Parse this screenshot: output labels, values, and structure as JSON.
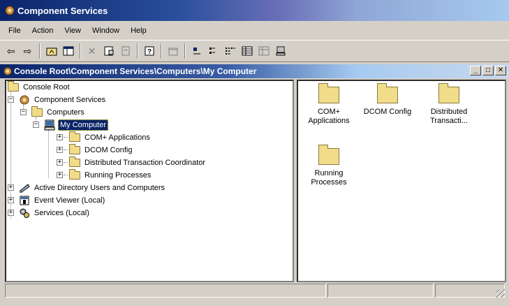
{
  "app": {
    "title": "Component Services"
  },
  "menu": [
    {
      "label": "File"
    },
    {
      "label": "Action"
    },
    {
      "label": "View"
    },
    {
      "label": "Window"
    },
    {
      "label": "Help"
    }
  ],
  "toolbar": {
    "buttons": [
      "back-arrow-icon",
      "forward-arrow-icon",
      "up-folder-icon",
      "show-hide-tree-icon",
      "delete-icon",
      "properties-icon",
      "refresh-icon",
      "help-icon",
      "new-window-icon",
      "large-icons-view-icon",
      "small-icons-view-icon",
      "list-view-icon",
      "details-view-icon",
      "disabled-view-icon",
      "computer-icon"
    ]
  },
  "child_window": {
    "title": "Console Root\\Component Services\\Computers\\My Computer"
  },
  "tree": {
    "nodes": [
      {
        "label": "Console Root"
      },
      {
        "label": "Component Services"
      },
      {
        "label": "Computers"
      },
      {
        "label": "My Computer",
        "selected": true
      },
      {
        "label": "COM+ Applications"
      },
      {
        "label": "DCOM Config"
      },
      {
        "label": "Distributed Transaction Coordinator"
      },
      {
        "label": "Running Processes"
      },
      {
        "label": "Active Directory Users and Computers"
      },
      {
        "label": "Event Viewer (Local)"
      },
      {
        "label": "Services (Local)"
      }
    ]
  },
  "list": {
    "items": [
      {
        "line1": "COM+",
        "line2": "Applications"
      },
      {
        "line1": "DCOM Config",
        "line2": ""
      },
      {
        "line1": "Distributed",
        "line2": "Transacti..."
      },
      {
        "line1": "Running",
        "line2": "Processes"
      }
    ]
  }
}
